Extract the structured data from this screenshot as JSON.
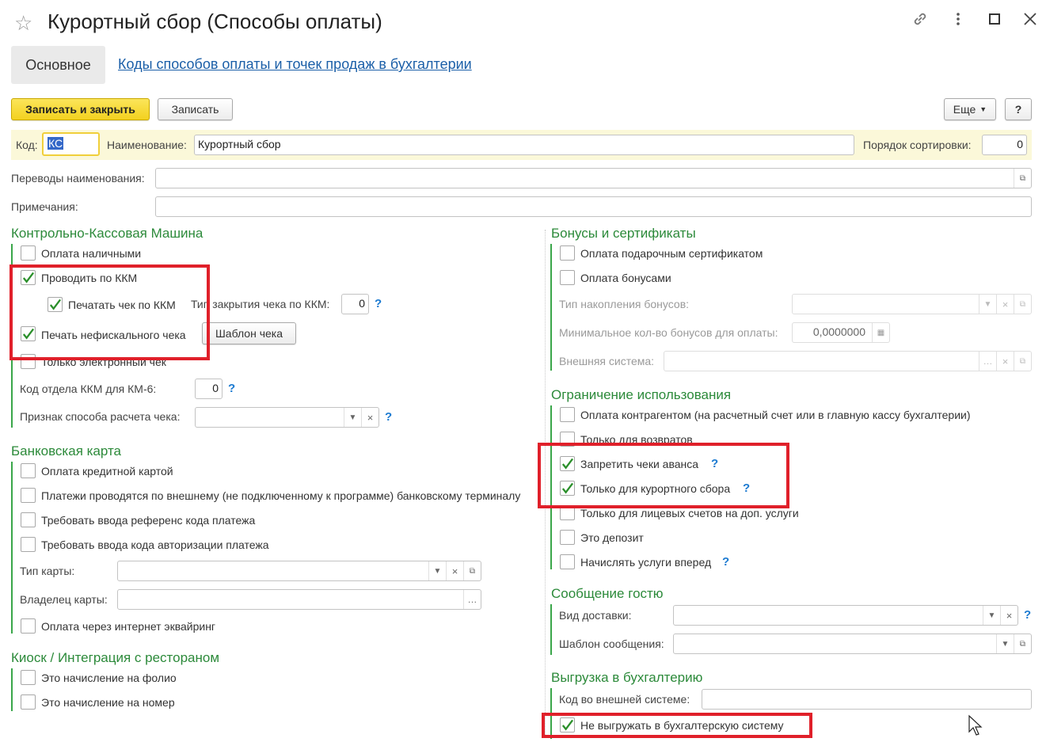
{
  "window": {
    "title": "Курортный сбор (Способы оплаты)"
  },
  "tabs": {
    "main": "Основное",
    "codes": "Коды способов оплаты и точек продаж в бухгалтерии"
  },
  "toolbar": {
    "save_close": "Записать и закрыть",
    "save": "Записать",
    "more": "Еще",
    "help": "?"
  },
  "header": {
    "code_label": "Код:",
    "code_value": "КС",
    "name_label": "Наименование:",
    "name_value": "Курортный сбор",
    "sort_label": "Порядок сортировки:",
    "sort_value": "0"
  },
  "fields": {
    "translations_label": "Переводы наименования:",
    "translations_value": "",
    "notes_label": "Примечания:",
    "notes_value": ""
  },
  "kkm": {
    "title": "Контрольно-Кассовая Машина",
    "cash": "Оплата наличными",
    "via_kkm": "Проводить по ККМ",
    "print_receipt": "Печатать чек по ККМ",
    "close_type_label": "Тип закрытия чека по ККМ:",
    "close_type_value": "0",
    "print_nonfiscal": "Печать нефискального чека",
    "template_btn": "Шаблон чека",
    "electronic_only": "Только электронный чек",
    "dept_label": "Код отдела ККМ для КМ-6:",
    "dept_value": "0",
    "calc_method_label": "Признак способа расчета чека:",
    "calc_method_value": ""
  },
  "bank": {
    "title": "Банковская карта",
    "credit": "Оплата кредитной картой",
    "external": "Платежи проводятся по внешнему (не подключенному к программе) банковскому терминалу",
    "ref_code": "Требовать ввода референс кода платежа",
    "auth_code": "Требовать ввода кода авторизации платежа",
    "card_type_label": "Тип карты:",
    "card_type_value": "",
    "owner_label": "Владелец карты:",
    "owner_value": "",
    "internet": "Оплата через интернет эквайринг"
  },
  "kiosk": {
    "title": "Киоск / Интеграция с рестораном",
    "folio": "Это начисление на фолио",
    "room": "Это начисление на номер"
  },
  "bonus": {
    "title": "Бонусы и сертификаты",
    "gift": "Оплата подарочным сертификатом",
    "bonuses": "Оплата бонусами",
    "accum_label": "Тип накопления бонусов:",
    "accum_value": "",
    "min_label": "Минимальное кол-во бонусов для оплаты:",
    "min_value": "0,0000000",
    "ext_label": "Внешняя система:",
    "ext_value": ""
  },
  "limits": {
    "title": "Ограничение использования",
    "contractor": "Оплата контрагентом (на расчетный счет или в главную кассу бухгалтерии)",
    "returns": "Только для возвратов",
    "no_advance": "Запретить чеки аванса",
    "resort_only": "Только для курортного сбора",
    "personal": "Только для лицевых счетов на доп. услуги",
    "deposit": "Это депозит",
    "advance": "Начислять услуги вперед"
  },
  "guest": {
    "title": "Сообщение гостю",
    "delivery_label": "Вид доставки:",
    "delivery_value": "",
    "template_label": "Шаблон сообщения:",
    "template_value": ""
  },
  "export": {
    "title": "Выгрузка в бухгалтерию",
    "ext_code_label": "Код во внешней системе:",
    "ext_code_value": "",
    "no_export": "Не выгружать в бухгалтерскую систему"
  },
  "colors": {
    "accent_green": "#2c8a3a",
    "link_blue": "#1b5fa8",
    "primary_yellow": "#f3d11f",
    "highlight_red": "#e0202a"
  }
}
